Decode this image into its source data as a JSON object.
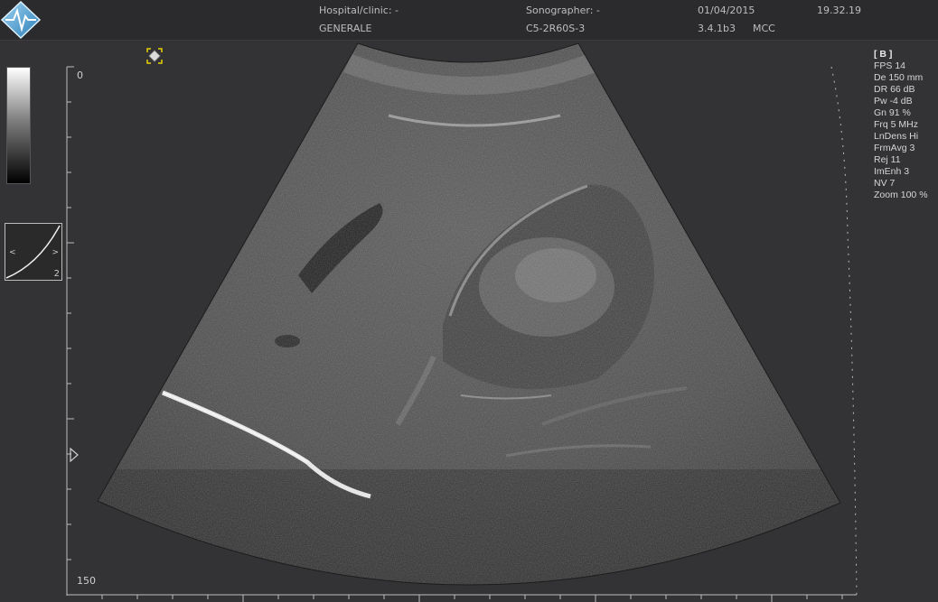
{
  "header": {
    "hospital_label": "Hospital/clinic: -",
    "preset": "GENERALE",
    "sonographer_label": "Sonographer: -",
    "probe": "C5-2R60S-3",
    "date": "01/04/2015",
    "time": "19.32.19",
    "software_version": "3.4.1b3",
    "mode_tag": "MCC"
  },
  "curve_panel": {
    "value": "2",
    "left_arrow": "<",
    "right_arrow": ">"
  },
  "depth_scale": {
    "top": "0",
    "bottom": "150"
  },
  "params": {
    "mode": "[ B ]",
    "items": [
      "FPS 14",
      "De 150 mm",
      "DR 66 dB",
      "Pw -4 dB",
      "Gn 91 %",
      "Frq 5 MHz",
      "LnDens Hi",
      "FrmAvg 3",
      "Rej 11",
      "ImEnh 3",
      "NV 7",
      "Zoom 100 %"
    ]
  }
}
